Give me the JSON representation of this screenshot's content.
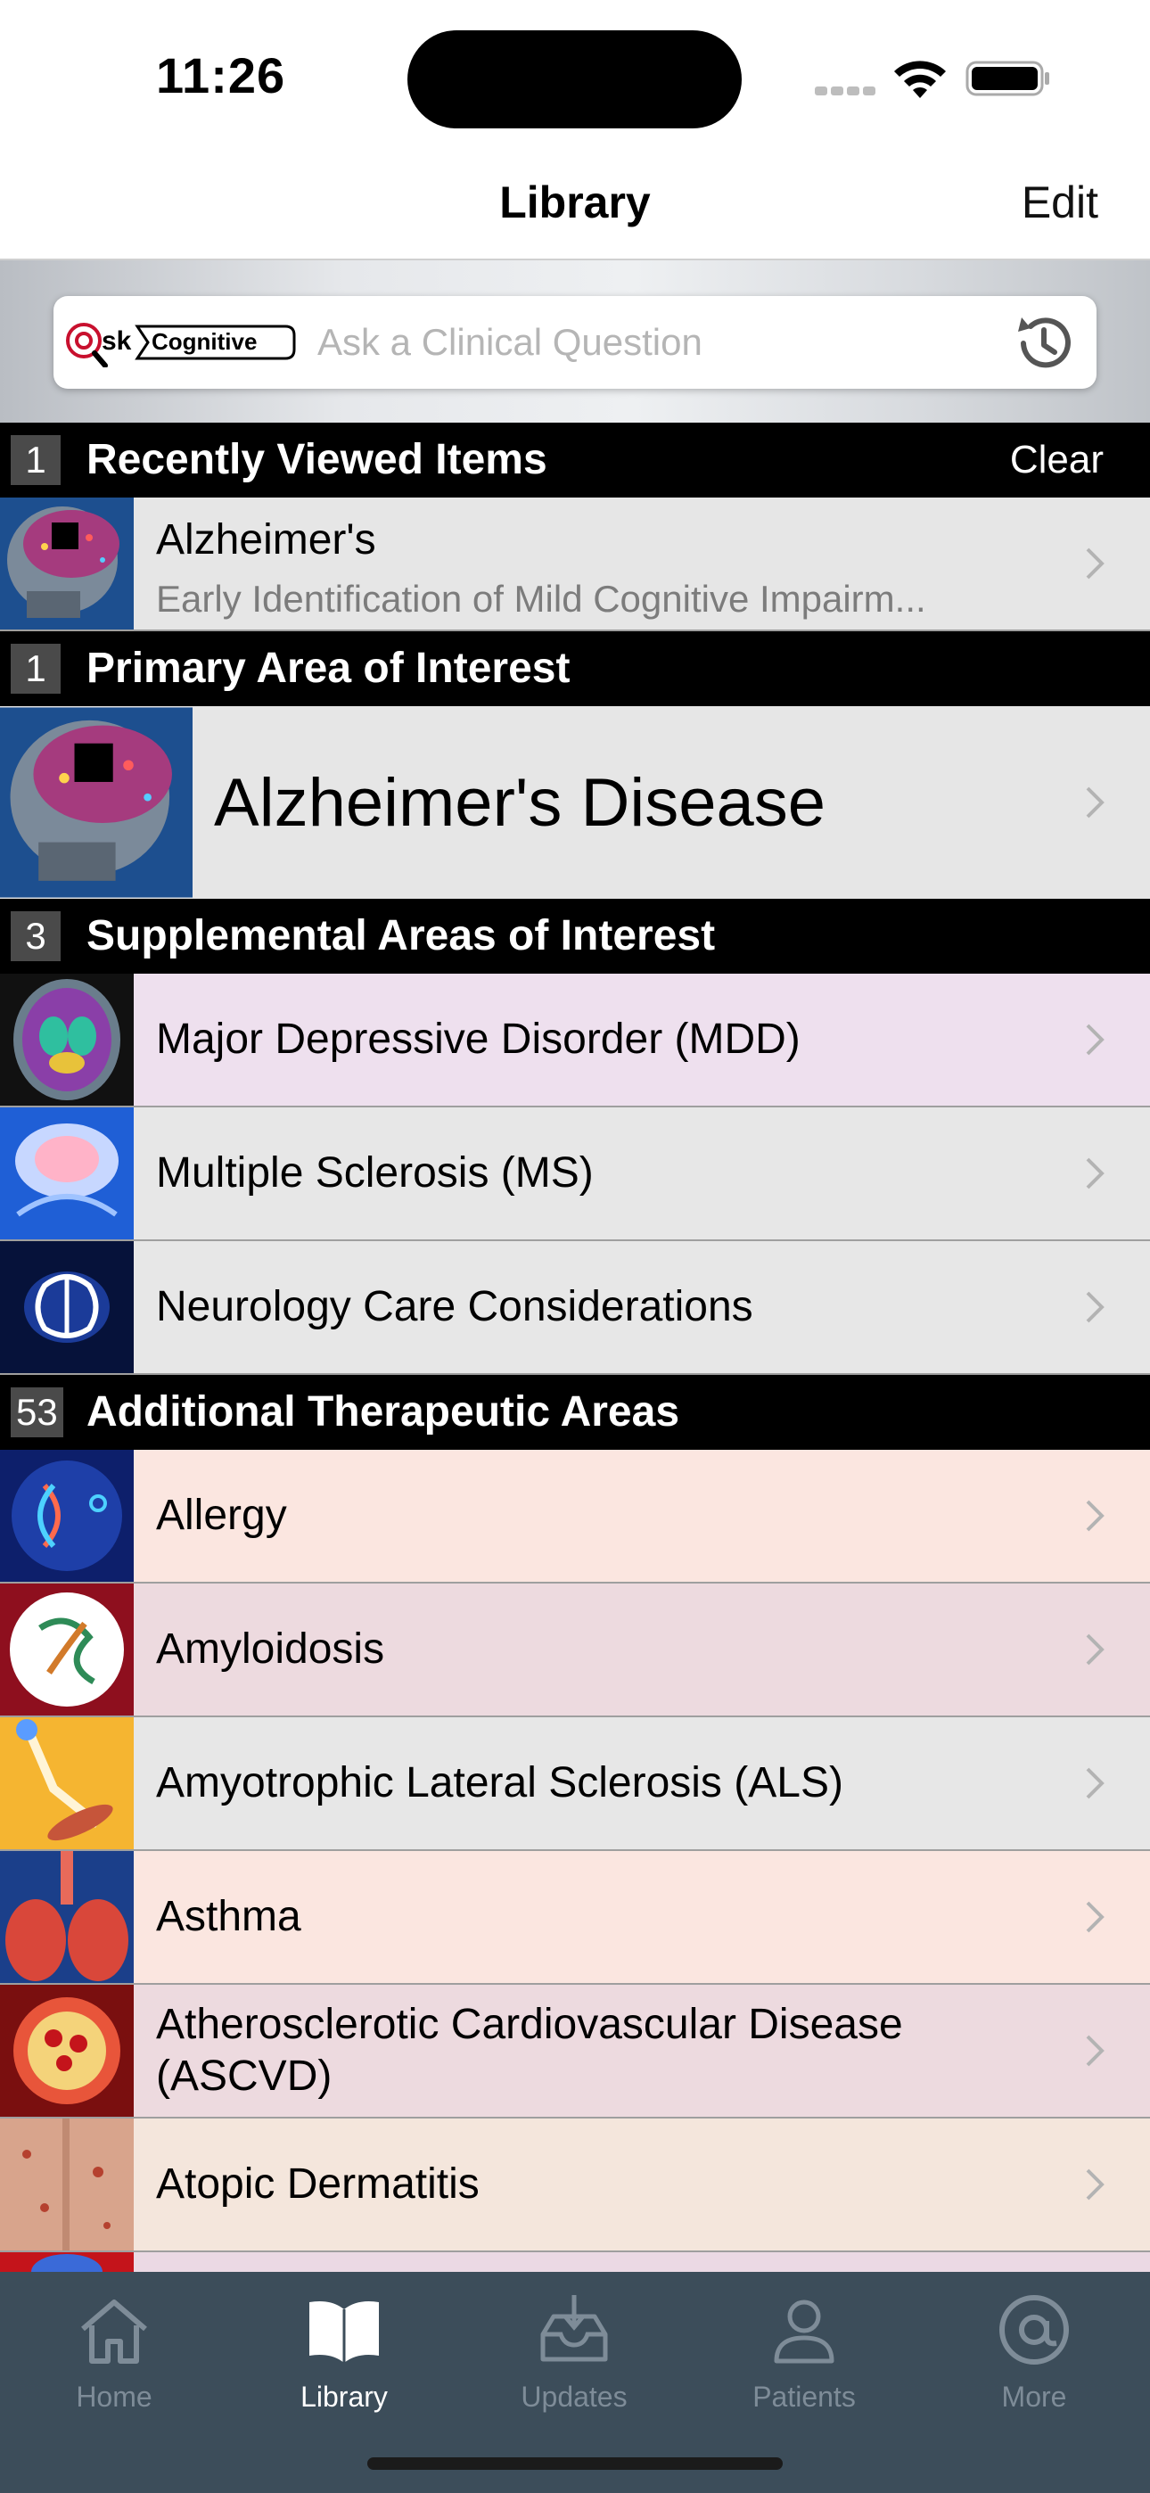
{
  "status_bar": {
    "time": "11:26"
  },
  "nav": {
    "title": "Library",
    "edit_label": "Edit"
  },
  "search": {
    "logo_text": "Cognitive",
    "logo_prefix": "@sk",
    "placeholder": "Ask a Clinical Question"
  },
  "sections": {
    "recent": {
      "count": "1",
      "title": "Recently Viewed Items",
      "action": "Clear"
    },
    "primary": {
      "count": "1",
      "title": "Primary Area of Interest"
    },
    "supplemental": {
      "count": "3",
      "title": "Supplemental Areas of Interest"
    },
    "additional": {
      "count": "53",
      "title": "Additional Therapeutic Areas"
    }
  },
  "recent_items": [
    {
      "title": "Alzheimer's",
      "subtitle": "Early Identification of Mild Cognitive Impairm..."
    }
  ],
  "primary_item": {
    "label": "Alzheimer's Disease"
  },
  "supplemental_items": [
    {
      "label": "Major Depressive Disorder (MDD)",
      "bg": "#eee0ee"
    },
    {
      "label": "Multiple Sclerosis (MS)",
      "bg": "#e7e7e7"
    },
    {
      "label": "Neurology Care Considerations",
      "bg": "#e7e7e7"
    }
  ],
  "additional_items": [
    {
      "label": "Allergy",
      "bg": "#fbe6e0"
    },
    {
      "label": "Amyloidosis",
      "bg": "#eddadf"
    },
    {
      "label": "Amyotrophic Lateral Sclerosis (ALS)",
      "bg": "#e7e7e7"
    },
    {
      "label": "Asthma",
      "bg": "#fbe6e0"
    },
    {
      "label": "Atherosclerotic Cardiovascular Disease (ASCVD)",
      "bg": "#eddadf"
    },
    {
      "label": "Atopic Dermatitis",
      "bg": "#f4e6dc"
    }
  ],
  "tabs": [
    {
      "label": "Home",
      "icon": "home-icon",
      "active": false
    },
    {
      "label": "Library",
      "icon": "book-icon",
      "active": true
    },
    {
      "label": "Updates",
      "icon": "inbox-download-icon",
      "active": false
    },
    {
      "label": "Patients",
      "icon": "person-icon",
      "active": false
    },
    {
      "label": "More",
      "icon": "at-sign-icon",
      "active": false
    }
  ]
}
